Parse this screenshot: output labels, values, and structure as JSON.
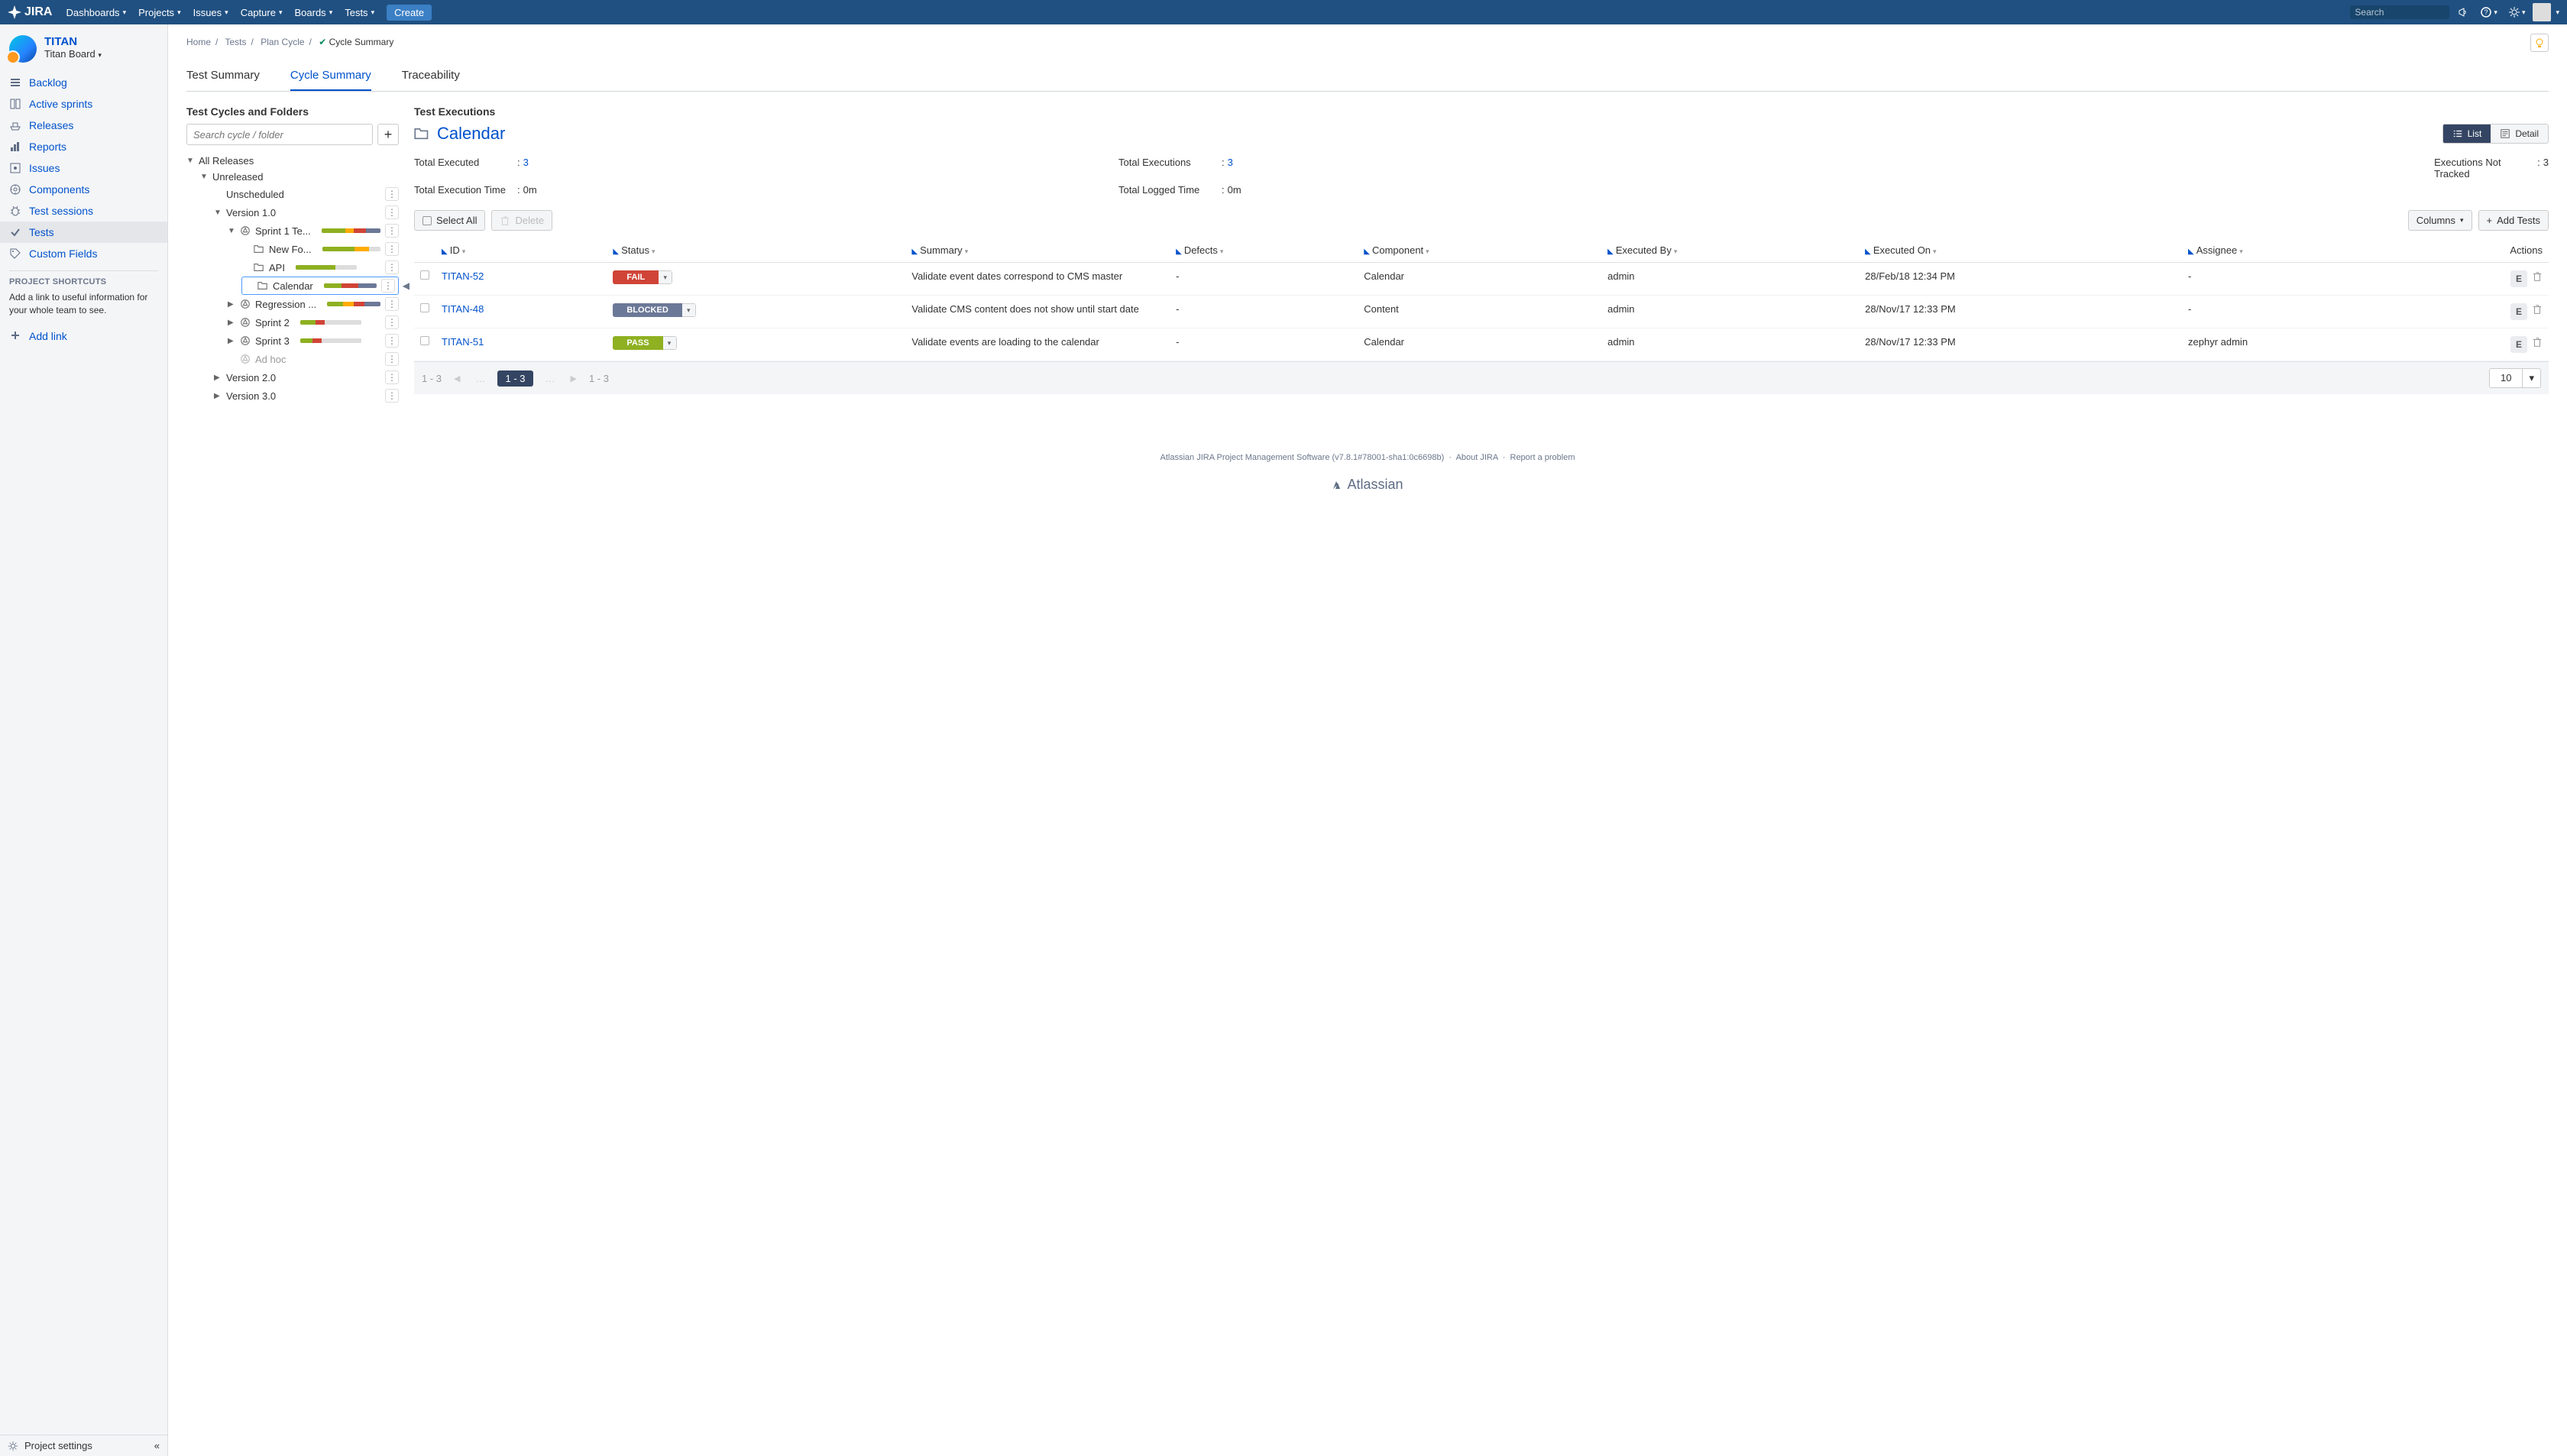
{
  "topnav": {
    "logo": "JIRA",
    "menu": [
      "Dashboards",
      "Projects",
      "Issues",
      "Capture",
      "Boards",
      "Tests"
    ],
    "create": "Create",
    "search_placeholder": "Search"
  },
  "project": {
    "name": "TITAN",
    "board": "Titan Board"
  },
  "sidebar": {
    "items": [
      {
        "icon": "backlog",
        "label": "Backlog"
      },
      {
        "icon": "sprints",
        "label": "Active sprints"
      },
      {
        "icon": "releases",
        "label": "Releases"
      },
      {
        "icon": "reports",
        "label": "Reports"
      },
      {
        "icon": "issues",
        "label": "Issues"
      },
      {
        "icon": "components",
        "label": "Components"
      },
      {
        "icon": "sessions",
        "label": "Test sessions"
      },
      {
        "icon": "tests",
        "label": "Tests",
        "active": true
      },
      {
        "icon": "fields",
        "label": "Custom Fields"
      }
    ],
    "shortcuts_title": "PROJECT SHORTCUTS",
    "shortcuts_help": "Add a link to useful information for your whole team to see.",
    "add_link": "Add link",
    "settings": "Project settings"
  },
  "breadcrumb": [
    "Home",
    "Tests",
    "Plan Cycle",
    "Cycle Summary"
  ],
  "tabs": [
    "Test Summary",
    "Cycle Summary",
    "Traceability"
  ],
  "active_tab": "Cycle Summary",
  "left_title": "Test Cycles and Folders",
  "right_title": "Test Executions",
  "tree_search_placeholder": "Search cycle / folder",
  "tree": {
    "root": "All Releases",
    "unreleased": "Unreleased",
    "unscheduled": "Unscheduled",
    "v1": "Version 1.0",
    "sprint1": "Sprint 1 Te...",
    "newfo": "New Fo...",
    "api": "API",
    "calendar": "Calendar",
    "regression": "Regression ...",
    "sprint2": "Sprint 2",
    "sprint3": "Sprint 3",
    "adhoc": "Ad hoc",
    "v2": "Version 2.0",
    "v3": "Version 3.0"
  },
  "executions": {
    "folder": "Calendar",
    "views": {
      "list": "List",
      "detail": "Detail"
    },
    "stats": [
      {
        "k": "Total Executed",
        "v": "3",
        "link": true
      },
      {
        "k": "Total Executions",
        "v": "3",
        "link": true
      },
      {
        "k": "Executions Not Tracked",
        "v": "3",
        "link": false
      },
      {
        "k": "Total Execution Time",
        "v": "0m",
        "link": false
      },
      {
        "k": "Total Logged Time",
        "v": "0m",
        "link": false
      }
    ],
    "bar": {
      "select": "Select All",
      "delete": "Delete",
      "columns": "Columns",
      "add": "Add Tests"
    },
    "columns": [
      "ID",
      "Status",
      "Summary",
      "Defects",
      "Component",
      "Executed By",
      "Executed On",
      "Assignee",
      "Actions"
    ],
    "rows": [
      {
        "id": "TITAN-52",
        "status": "FAIL",
        "status_class": "fail",
        "summary": "Validate event dates correspond to CMS master",
        "defects": "-",
        "component": "Calendar",
        "by": "admin",
        "on": "28/Feb/18 12:34 PM",
        "assignee": "-"
      },
      {
        "id": "TITAN-48",
        "status": "BLOCKED",
        "status_class": "blocked",
        "summary": "Validate CMS content does not show until start date",
        "defects": "-",
        "component": "Content",
        "by": "admin",
        "on": "28/Nov/17 12:33 PM",
        "assignee": "-"
      },
      {
        "id": "TITAN-51",
        "status": "PASS",
        "status_class": "pass",
        "summary": "Validate events are loading to the calendar",
        "defects": "-",
        "component": "Calendar",
        "by": "admin",
        "on": "28/Nov/17 12:33 PM",
        "assignee": "zephyr admin"
      }
    ],
    "pager": {
      "range": "1 - 3",
      "active": "1 - 3",
      "per_page": "10"
    }
  },
  "footer": {
    "line": "Atlassian JIRA Project Management Software (v7.8.1#78001-sha1:0c6698b)",
    "about": "About JIRA",
    "report": "Report a problem",
    "brand": "Atlassian"
  }
}
